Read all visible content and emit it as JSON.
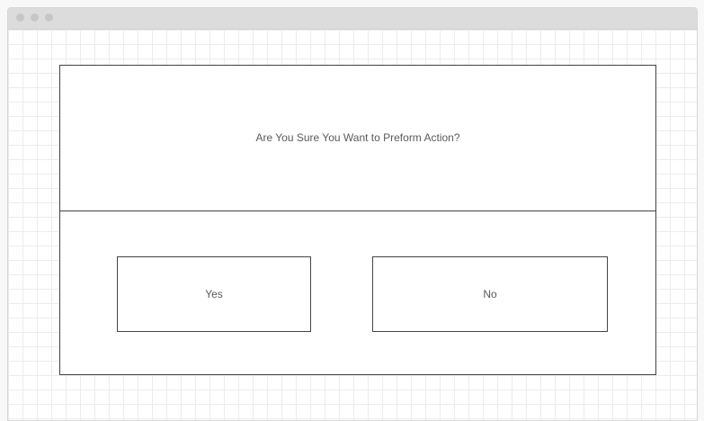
{
  "dialog": {
    "message": "Are You Sure You Want to Preform Action?",
    "yes_label": "Yes",
    "no_label": "No"
  },
  "window": {
    "controls": [
      "window-dot",
      "window-dot",
      "window-dot"
    ]
  },
  "colors": {
    "border": "#444444",
    "text": "#5a5a5a",
    "titlebar": "#dcdcdc",
    "grid": "#ececec"
  }
}
